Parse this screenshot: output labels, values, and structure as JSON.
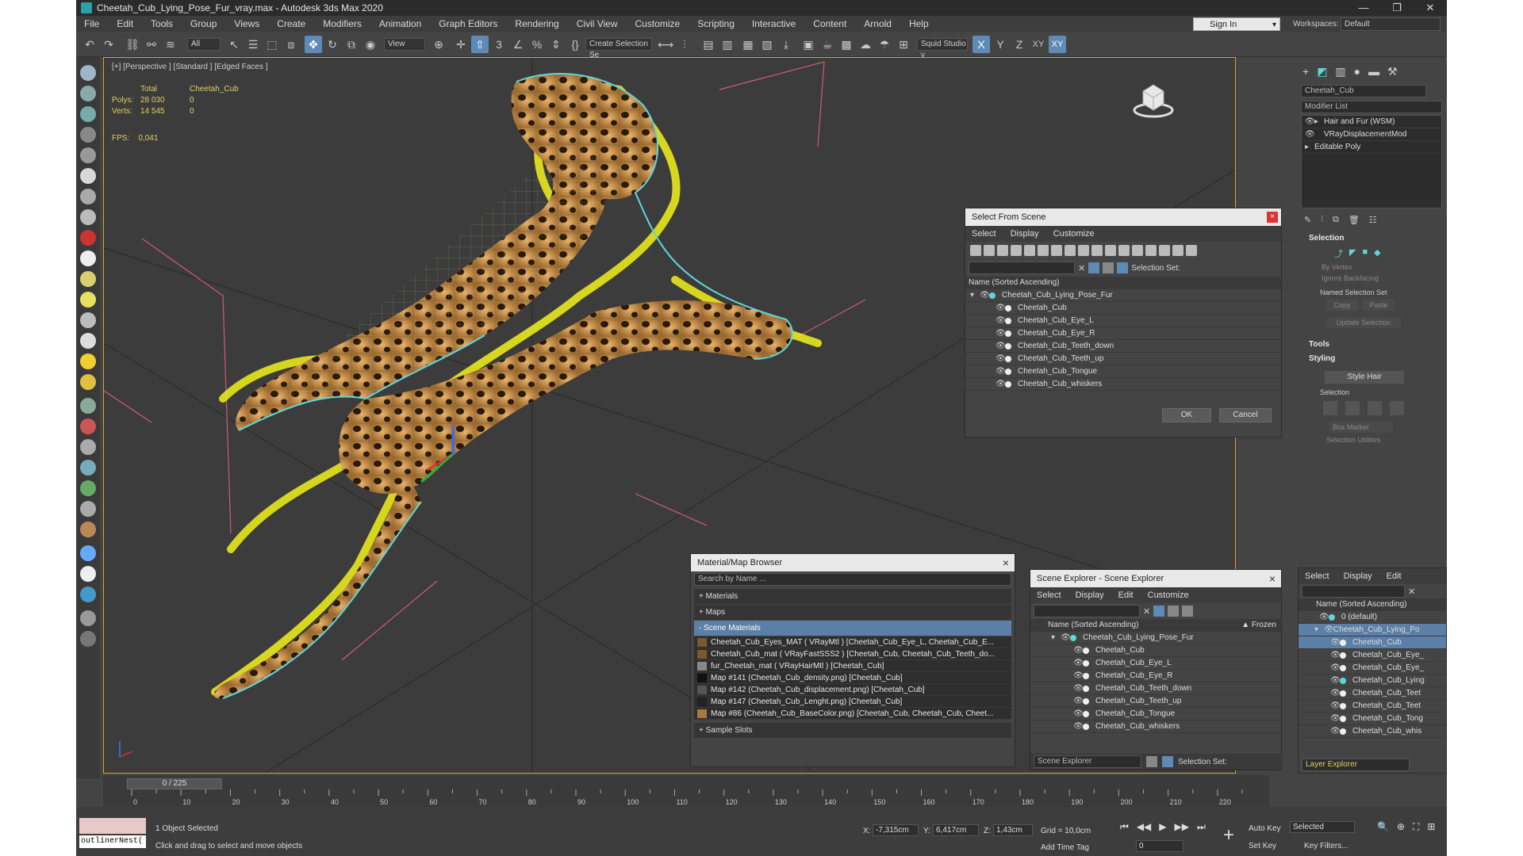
{
  "window": {
    "title": "Cheetah_Cub_Lying_Pose_Fur_vray.max - Autodesk 3ds Max 2020",
    "controls": [
      "—",
      "❐",
      "✕"
    ]
  },
  "menu": [
    "File",
    "Edit",
    "Tools",
    "Group",
    "Views",
    "Create",
    "Modifiers",
    "Animation",
    "Graph Editors",
    "Rendering",
    "Civil View",
    "Customize",
    "Scripting",
    "Interactive",
    "Content",
    "Arnold",
    "Help"
  ],
  "signin": "Sign In",
  "workspace": {
    "label": "Workspaces:",
    "value": "Default"
  },
  "toolbar": {
    "filter": "All",
    "refcoord": "View",
    "selset": "Create Selection Se",
    "squid": "Squid Studio v",
    "axes": [
      "X",
      "Y",
      "Z",
      "XY",
      "XY"
    ]
  },
  "viewport": {
    "label": "[+] [Perspective ] [Standard ] [Edged Faces ]",
    "stats": {
      "header": [
        "",
        "Total",
        "Cheetah_Cub"
      ],
      "polys": [
        "Polys:",
        "28 030",
        "0"
      ],
      "verts": [
        "Verts:",
        "14 545",
        "0"
      ]
    },
    "fps": [
      "FPS:",
      "0,041"
    ]
  },
  "select_from_scene": {
    "title": "Select From Scene",
    "menu": [
      "Select",
      "Display",
      "Customize"
    ],
    "selection_set_label": "Selection Set:",
    "column": "Name (Sorted Ascending)",
    "root": "Cheetah_Cub_Lying_Pose_Fur",
    "items": [
      "Cheetah_Cub",
      "Cheetah_Cub_Eye_L",
      "Cheetah_Cub_Eye_R",
      "Cheetah_Cub_Teeth_down",
      "Cheetah_Cub_Teeth_up",
      "Cheetah_Cub_Tongue",
      "Cheetah_Cub_whiskers"
    ],
    "ok": "OK",
    "cancel": "Cancel"
  },
  "material_browser": {
    "title": "Material/Map Browser",
    "search_placeholder": "Search by Name ...",
    "materials": "+ Materials",
    "maps": "+ Maps",
    "scene_materials": "- Scene Materials",
    "rows": [
      "Cheetah_Cub_Eyes_MAT ( VRayMtl ) [Cheetah_Cub_Eye_L, Cheetah_Cub_E...",
      "Cheetah_Cub_mat ( VRayFastSSS2 ) [Cheetah_Cub, Cheetah_Cub_Teeth_do...",
      "fur_Cheetah_mat ( VRayHairMtl ) [Cheetah_Cub]",
      "Map #141 (Cheetah_Cub_density.png) [Cheetah_Cub]",
      "Map #142 (Cheetah_Cub_displacement.png) [Cheetah_Cub]",
      "Map #147 (Cheetah_Cub_Lenght.png) [Cheetah_Cub]",
      "Map #86 (Cheetah_Cub_BaseColor.png) [Cheetah_Cub, Cheetah_Cub, Cheet..."
    ],
    "sample_slots": "+ Sample Slots"
  },
  "scene_explorer": {
    "title": "Scene Explorer - Scene Explorer",
    "menu": [
      "Select",
      "Display",
      "Edit",
      "Customize"
    ],
    "column": "Name (Sorted Ascending)",
    "frozen": "▲ Frozen",
    "root": "Cheetah_Cub_Lying_Pose_Fur",
    "items": [
      "Cheetah_Cub",
      "Cheetah_Cub_Eye_L",
      "Cheetah_Cub_Eye_R",
      "Cheetah_Cub_Teeth_down",
      "Cheetah_Cub_Teeth_up",
      "Cheetah_Cub_Tongue",
      "Cheetah_Cub_whiskers"
    ],
    "footer_dd": "Scene Explorer",
    "selection_set_label": "Selection Set:"
  },
  "command_panel": {
    "object_name": "Cheetah_Cub",
    "modifier_list": "Modifier List",
    "stack": [
      "Hair and Fur (WSM)",
      "VRayDisplacementMod",
      "Editable Poly"
    ],
    "selection": "Selection",
    "by_vertex": "By Vertex",
    "ignore_backfacing": "Ignore Backfacing",
    "named_selection_set": "Named Selection Set",
    "copy": "Copy",
    "paste": "Paste",
    "update_selection": "Update Selection",
    "tools": "Tools",
    "styling": "Styling",
    "style_hair": "Style Hair",
    "selection_sub": "Selection",
    "box_marker": "Box Marker",
    "selection_utilities": "Selection Utilities"
  },
  "layer_explorer": {
    "menu": [
      "Select",
      "Display",
      "Edit"
    ],
    "column": "Name (Sorted Ascending)",
    "rows": [
      "0 (default)",
      "Cheetah_Cub_Lying_Po",
      "Cheetah_Cub",
      "Cheetah_Cub_Eye_",
      "Cheetah_Cub_Eye_",
      "Cheetah_Cub_Lying",
      "Cheetah_Cub_Teet",
      "Cheetah_Cub_Teet",
      "Cheetah_Cub_Tong",
      "Cheetah_Cub_whis"
    ],
    "footer": "Layer Explorer"
  },
  "timeline": {
    "frame": "0 / 225",
    "ticks": [
      "0",
      "10",
      "20",
      "30",
      "40",
      "50",
      "60",
      "70",
      "80",
      "90",
      "100",
      "110",
      "120",
      "130",
      "140",
      "150",
      "160",
      "170",
      "180",
      "190",
      "200",
      "210",
      "220"
    ]
  },
  "status": {
    "maxscript": "outlinerNest(",
    "selected": "1 Object Selected",
    "hint": "Click and drag to select and move objects",
    "x_label": "X:",
    "x": "-7,315cm",
    "y_label": "Y:",
    "y": "6,417cm",
    "z_label": "Z:",
    "z": "1,43cm",
    "grid": "Grid = 10,0cm",
    "add_time_tag": "Add Time Tag",
    "frame_value": "0",
    "auto_key": "Auto Key",
    "auto_key_dd": "Selected",
    "set_key": "Set Key",
    "key_filters": "Key Filters..."
  },
  "colors": {
    "accent": "#5e8ab6",
    "viewport_border": "#d8a526",
    "fur": "#f2f21a",
    "outline": "#5fd6dc",
    "body": "#c7904a"
  }
}
